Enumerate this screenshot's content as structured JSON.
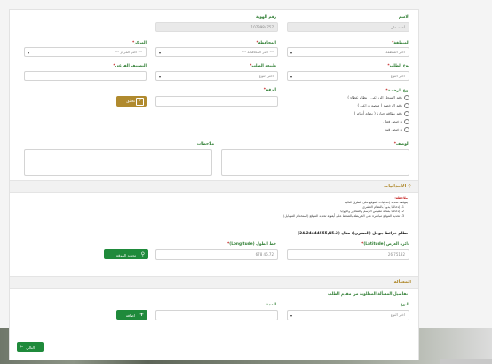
{
  "form": {
    "name_label": "الاسم",
    "name_value": "أحمد علي",
    "id_label": "رقم الهوية",
    "id_value": "1079984757",
    "region_label": "المنطقة",
    "region_value": "اختر المنطقة",
    "governorate_label": "المحافظة",
    "governorate_value": "--- اختر المحافظة ---",
    "center_label": "المركز",
    "center_value": "--- اختر المركز ---",
    "request_type_label": "نوع الطلب",
    "request_type_value": "اختر النوع",
    "request_nature_label": "طبيعة الطلب",
    "request_nature_value": "اختر النوع",
    "sub_category_label": "التصنيف الفرعي",
    "sub_category_value": "",
    "number_label": "الرقم",
    "number_value": "",
    "verify_button": "تحقق",
    "license_type_label": "نوع الرخصة",
    "license_options": [
      "رقم السجل الزراعي ( نظام عطاء )",
      "رقم الرخصة ( منصة زراعي )",
      "رقم بطاقة حيازة ( نظام أنعام )",
      "ترخيص فعال",
      "ترخيص قيد"
    ],
    "description_label": "الوصف",
    "notes_label": "ملاحظات"
  },
  "coordinates": {
    "section_title": "الاحداثيات",
    "notes_title": "ملاحظة:",
    "notes": [
      "يتوقف تحديد إحداثيات الموقع على الطرق التالية",
      "1- إدخالها يدوياً بالنظام العشري",
      "2- إدخالها بمثابة مقياس الرسم والمحاور والزوايا",
      "3- تحديد الموقع مباشرة على الخريطة بالضغط على أيقونة تحديد الموقع (استخدام الموبايل)"
    ],
    "system_label": "نظام خرائط جوجل (العشري): مثال (24.24444555,45.2)",
    "lat_label": "دائرة العرض (Latitude)",
    "lat_value": "26.75182",
    "lng_label": "خط الطول (Longitude)",
    "lng_value": "46.72 678",
    "locate_button": "تحديد الموقع"
  },
  "issue": {
    "section_title": "المسألة",
    "details_title": "تفاصيل المسألة المطلوبة من مقدم الطلب",
    "type_label": "النوع",
    "type_value": "اختر النوع",
    "duration_label": "المدة",
    "duration_value": "",
    "add_button": "اضافة"
  },
  "footer": {
    "next_button": "التالي"
  },
  "colors": {
    "accent_green": "#1f8a3b",
    "label_green": "#2e7d32",
    "gold": "#b08a2e",
    "required_red": "#c62828"
  }
}
